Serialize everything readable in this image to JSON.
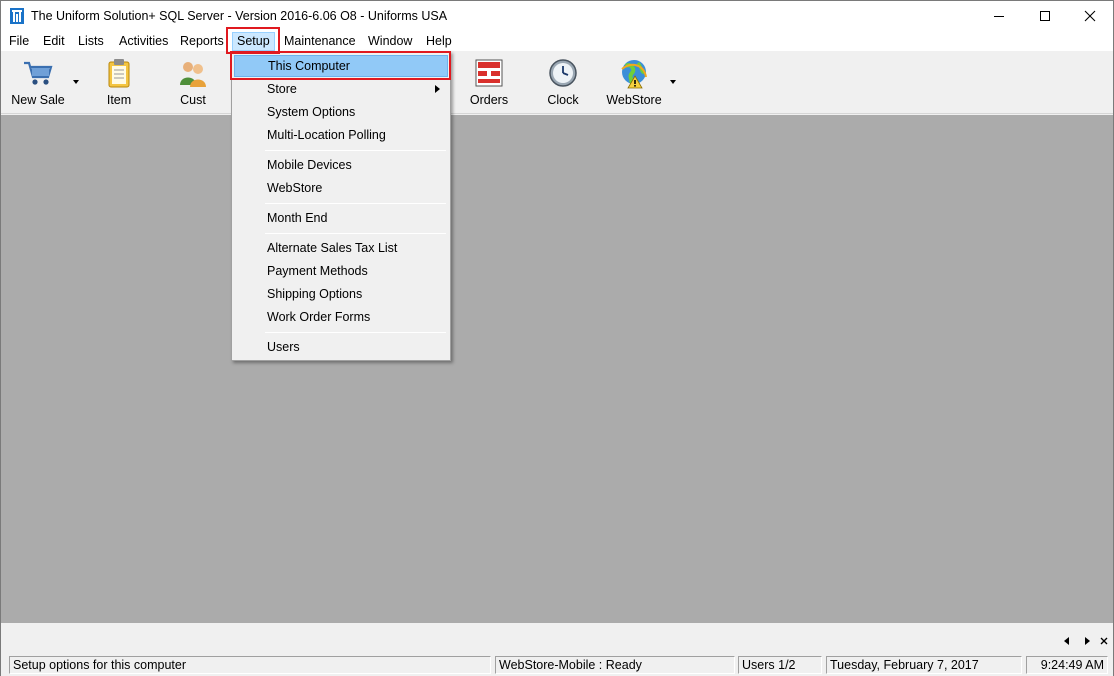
{
  "window": {
    "title": "The Uniform Solution+ SQL Server - Version 2016-6.06 O8 - Uniforms USA"
  },
  "menubar": {
    "items": [
      "File",
      "Edit",
      "Lists",
      "Activities",
      "Reports",
      "Setup",
      "Maintenance",
      "Window",
      "Help"
    ]
  },
  "toolbar": {
    "buttons": [
      {
        "label": "New Sale",
        "icon": "shopping-cart-icon"
      },
      {
        "label": "Item",
        "icon": "clipboard-icon"
      },
      {
        "label": "Cust",
        "icon": "people-icon"
      },
      {
        "label": "Orders",
        "icon": "orders-icon"
      },
      {
        "label": "Clock",
        "icon": "clock-icon"
      },
      {
        "label": "WebStore",
        "icon": "webstore-globe-icon"
      }
    ]
  },
  "setup_menu": {
    "items": [
      "This Computer",
      "Store",
      "System Options",
      "Multi-Location Polling",
      "Mobile Devices",
      "WebStore",
      "Month End",
      "Alternate Sales Tax List",
      "Payment Methods",
      "Shipping Options",
      "Work Order Forms",
      "Users"
    ],
    "active": "This Computer",
    "has_submenu": "Store"
  },
  "statusbar": {
    "message": "Setup options for this computer",
    "service": "WebStore-Mobile : Ready",
    "users": "Users 1/2",
    "date": "Tuesday, February  7, 2017",
    "time": "9:24:49 AM"
  },
  "colors": {
    "highlight_outline": "#e0191f",
    "menu_active": "#91c9f7",
    "mdi_background": "#ababab"
  }
}
